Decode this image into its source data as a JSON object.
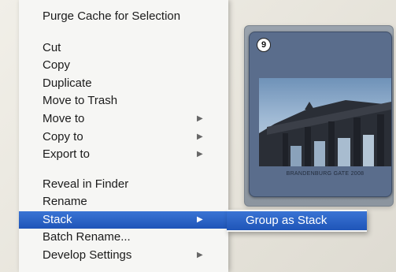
{
  "menu": {
    "items": [
      {
        "label": "Purge Cache for Selection",
        "has_submenu": false
      },
      {
        "label": "Cut",
        "has_submenu": false
      },
      {
        "label": "Copy",
        "has_submenu": false
      },
      {
        "label": "Duplicate",
        "has_submenu": false
      },
      {
        "label": "Move to Trash",
        "has_submenu": false
      },
      {
        "label": "Move to",
        "has_submenu": true
      },
      {
        "label": "Copy to",
        "has_submenu": true
      },
      {
        "label": "Export to",
        "has_submenu": true
      },
      {
        "label": "Reveal in Finder",
        "has_submenu": false
      },
      {
        "label": "Rename",
        "has_submenu": false
      },
      {
        "label": "Stack",
        "has_submenu": true,
        "highlighted": true
      },
      {
        "label": "Batch Rename...",
        "has_submenu": false
      },
      {
        "label": "Develop Settings",
        "has_submenu": true
      }
    ],
    "submenu_arrow": "▶"
  },
  "submenu": {
    "items": [
      {
        "label": "Group as Stack",
        "highlighted": true
      }
    ]
  },
  "thumbnail": {
    "badge": "9",
    "caption": "BRANDENBURG GATE 2008",
    "icon": "photo-thumbnail"
  },
  "colors": {
    "highlight": "#2b63c6",
    "menu_bg": "#f6f6f4",
    "thumbnail_bg": "#5a6d8c"
  }
}
